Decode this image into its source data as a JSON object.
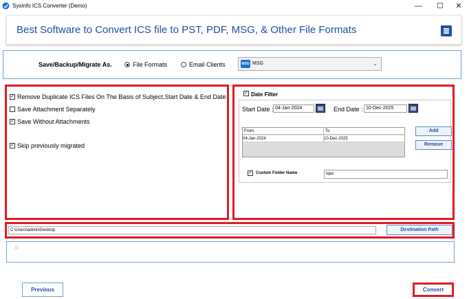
{
  "window": {
    "title": "SysInfo ICS Converter (Demo)",
    "minimize_glyph": "—",
    "maximize_glyph": "☐",
    "close_glyph": "✕"
  },
  "header": {
    "title": "Best Software to Convert ICS file to PST, PDF, MSG, & Other File Formats",
    "menu_icon": "hamburger-menu-icon",
    "accent_color": "#1f4fa3"
  },
  "save_as": {
    "label": "Save/Backup/Migrate As.",
    "options": [
      {
        "label": "File Formats",
        "selected": true
      },
      {
        "label": "Email Clients",
        "selected": false
      }
    ],
    "format_icon_text": "MSG",
    "format_value": "MSG"
  },
  "options": [
    {
      "label": "Remove Duplicate ICS Files On The Basis of Subject,Start Date & End Date",
      "checked": true
    },
    {
      "label": "Save Attachment Separately",
      "checked": false
    },
    {
      "label": "Save Without Attachments",
      "checked": true
    },
    {
      "label": "Skip previously migrated",
      "checked": true
    }
  ],
  "date_filter": {
    "label": "Date Filter",
    "checked": true,
    "start_label": "Start Date :",
    "start_value": "04-Jan-2024",
    "end_label": "End Date :",
    "end_value": "10-Dec-2025",
    "columns": [
      "From",
      "To"
    ],
    "rows": [
      {
        "from": "04-Jan-2024",
        "to": "10-Dec-2025"
      }
    ],
    "add_label": "Add",
    "remove_label": "Remove"
  },
  "custom_folder": {
    "label": "Custom Folder Name",
    "checked": true,
    "value": "tqaz"
  },
  "destination": {
    "path": "C:\\Users\\admin\\Desktop",
    "button_label": "Destination Path"
  },
  "footer": {
    "previous_label": "Previous",
    "convert_label": "Convert"
  },
  "colors": {
    "highlight_red": "#e01b24",
    "panel_border_blue": "#6f9fd1"
  }
}
